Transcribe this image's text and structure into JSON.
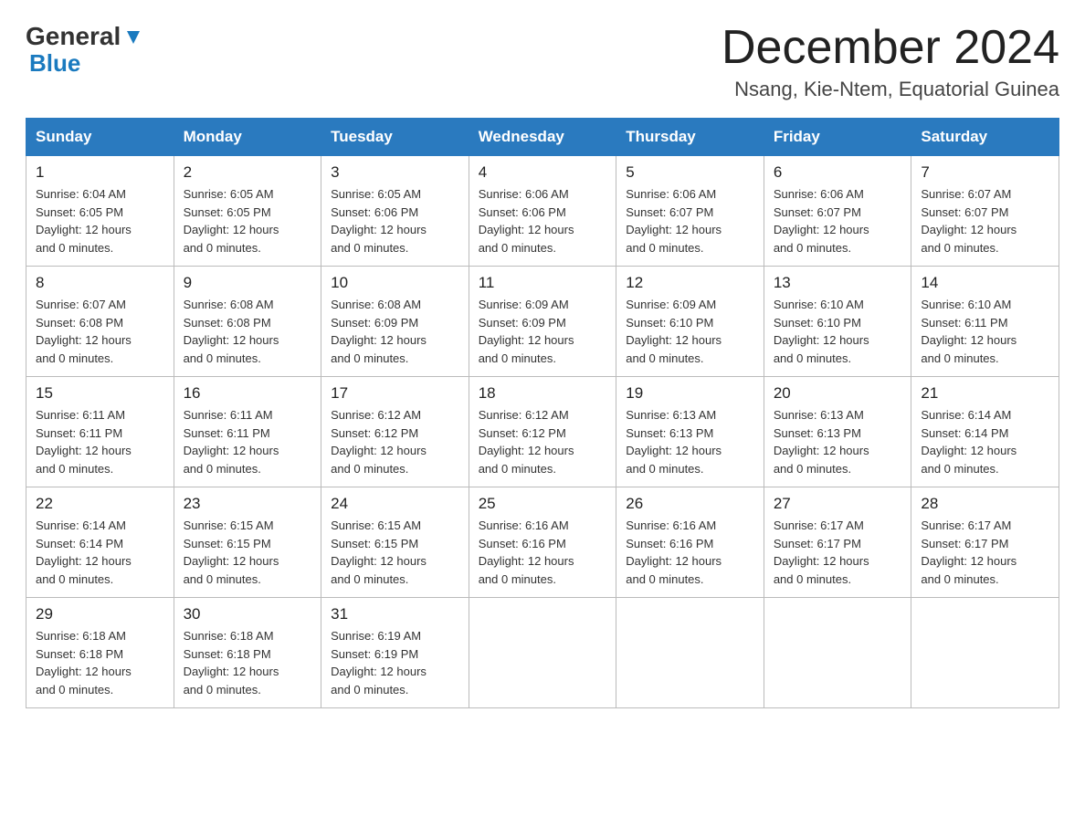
{
  "header": {
    "logo_general": "General",
    "logo_blue": "Blue",
    "title": "December 2024",
    "subtitle": "Nsang, Kie-Ntem, Equatorial Guinea"
  },
  "days_of_week": [
    "Sunday",
    "Monday",
    "Tuesday",
    "Wednesday",
    "Thursday",
    "Friday",
    "Saturday"
  ],
  "weeks": [
    [
      {
        "day": "1",
        "sunrise": "6:04 AM",
        "sunset": "6:05 PM",
        "daylight": "12 hours and 0 minutes."
      },
      {
        "day": "2",
        "sunrise": "6:05 AM",
        "sunset": "6:05 PM",
        "daylight": "12 hours and 0 minutes."
      },
      {
        "day": "3",
        "sunrise": "6:05 AM",
        "sunset": "6:06 PM",
        "daylight": "12 hours and 0 minutes."
      },
      {
        "day": "4",
        "sunrise": "6:06 AM",
        "sunset": "6:06 PM",
        "daylight": "12 hours and 0 minutes."
      },
      {
        "day": "5",
        "sunrise": "6:06 AM",
        "sunset": "6:07 PM",
        "daylight": "12 hours and 0 minutes."
      },
      {
        "day": "6",
        "sunrise": "6:06 AM",
        "sunset": "6:07 PM",
        "daylight": "12 hours and 0 minutes."
      },
      {
        "day": "7",
        "sunrise": "6:07 AM",
        "sunset": "6:07 PM",
        "daylight": "12 hours and 0 minutes."
      }
    ],
    [
      {
        "day": "8",
        "sunrise": "6:07 AM",
        "sunset": "6:08 PM",
        "daylight": "12 hours and 0 minutes."
      },
      {
        "day": "9",
        "sunrise": "6:08 AM",
        "sunset": "6:08 PM",
        "daylight": "12 hours and 0 minutes."
      },
      {
        "day": "10",
        "sunrise": "6:08 AM",
        "sunset": "6:09 PM",
        "daylight": "12 hours and 0 minutes."
      },
      {
        "day": "11",
        "sunrise": "6:09 AM",
        "sunset": "6:09 PM",
        "daylight": "12 hours and 0 minutes."
      },
      {
        "day": "12",
        "sunrise": "6:09 AM",
        "sunset": "6:10 PM",
        "daylight": "12 hours and 0 minutes."
      },
      {
        "day": "13",
        "sunrise": "6:10 AM",
        "sunset": "6:10 PM",
        "daylight": "12 hours and 0 minutes."
      },
      {
        "day": "14",
        "sunrise": "6:10 AM",
        "sunset": "6:11 PM",
        "daylight": "12 hours and 0 minutes."
      }
    ],
    [
      {
        "day": "15",
        "sunrise": "6:11 AM",
        "sunset": "6:11 PM",
        "daylight": "12 hours and 0 minutes."
      },
      {
        "day": "16",
        "sunrise": "6:11 AM",
        "sunset": "6:11 PM",
        "daylight": "12 hours and 0 minutes."
      },
      {
        "day": "17",
        "sunrise": "6:12 AM",
        "sunset": "6:12 PM",
        "daylight": "12 hours and 0 minutes."
      },
      {
        "day": "18",
        "sunrise": "6:12 AM",
        "sunset": "6:12 PM",
        "daylight": "12 hours and 0 minutes."
      },
      {
        "day": "19",
        "sunrise": "6:13 AM",
        "sunset": "6:13 PM",
        "daylight": "12 hours and 0 minutes."
      },
      {
        "day": "20",
        "sunrise": "6:13 AM",
        "sunset": "6:13 PM",
        "daylight": "12 hours and 0 minutes."
      },
      {
        "day": "21",
        "sunrise": "6:14 AM",
        "sunset": "6:14 PM",
        "daylight": "12 hours and 0 minutes."
      }
    ],
    [
      {
        "day": "22",
        "sunrise": "6:14 AM",
        "sunset": "6:14 PM",
        "daylight": "12 hours and 0 minutes."
      },
      {
        "day": "23",
        "sunrise": "6:15 AM",
        "sunset": "6:15 PM",
        "daylight": "12 hours and 0 minutes."
      },
      {
        "day": "24",
        "sunrise": "6:15 AM",
        "sunset": "6:15 PM",
        "daylight": "12 hours and 0 minutes."
      },
      {
        "day": "25",
        "sunrise": "6:16 AM",
        "sunset": "6:16 PM",
        "daylight": "12 hours and 0 minutes."
      },
      {
        "day": "26",
        "sunrise": "6:16 AM",
        "sunset": "6:16 PM",
        "daylight": "12 hours and 0 minutes."
      },
      {
        "day": "27",
        "sunrise": "6:17 AM",
        "sunset": "6:17 PM",
        "daylight": "12 hours and 0 minutes."
      },
      {
        "day": "28",
        "sunrise": "6:17 AM",
        "sunset": "6:17 PM",
        "daylight": "12 hours and 0 minutes."
      }
    ],
    [
      {
        "day": "29",
        "sunrise": "6:18 AM",
        "sunset": "6:18 PM",
        "daylight": "12 hours and 0 minutes."
      },
      {
        "day": "30",
        "sunrise": "6:18 AM",
        "sunset": "6:18 PM",
        "daylight": "12 hours and 0 minutes."
      },
      {
        "day": "31",
        "sunrise": "6:19 AM",
        "sunset": "6:19 PM",
        "daylight": "12 hours and 0 minutes."
      },
      null,
      null,
      null,
      null
    ]
  ],
  "labels": {
    "sunrise": "Sunrise:",
    "sunset": "Sunset:",
    "daylight": "Daylight:"
  }
}
